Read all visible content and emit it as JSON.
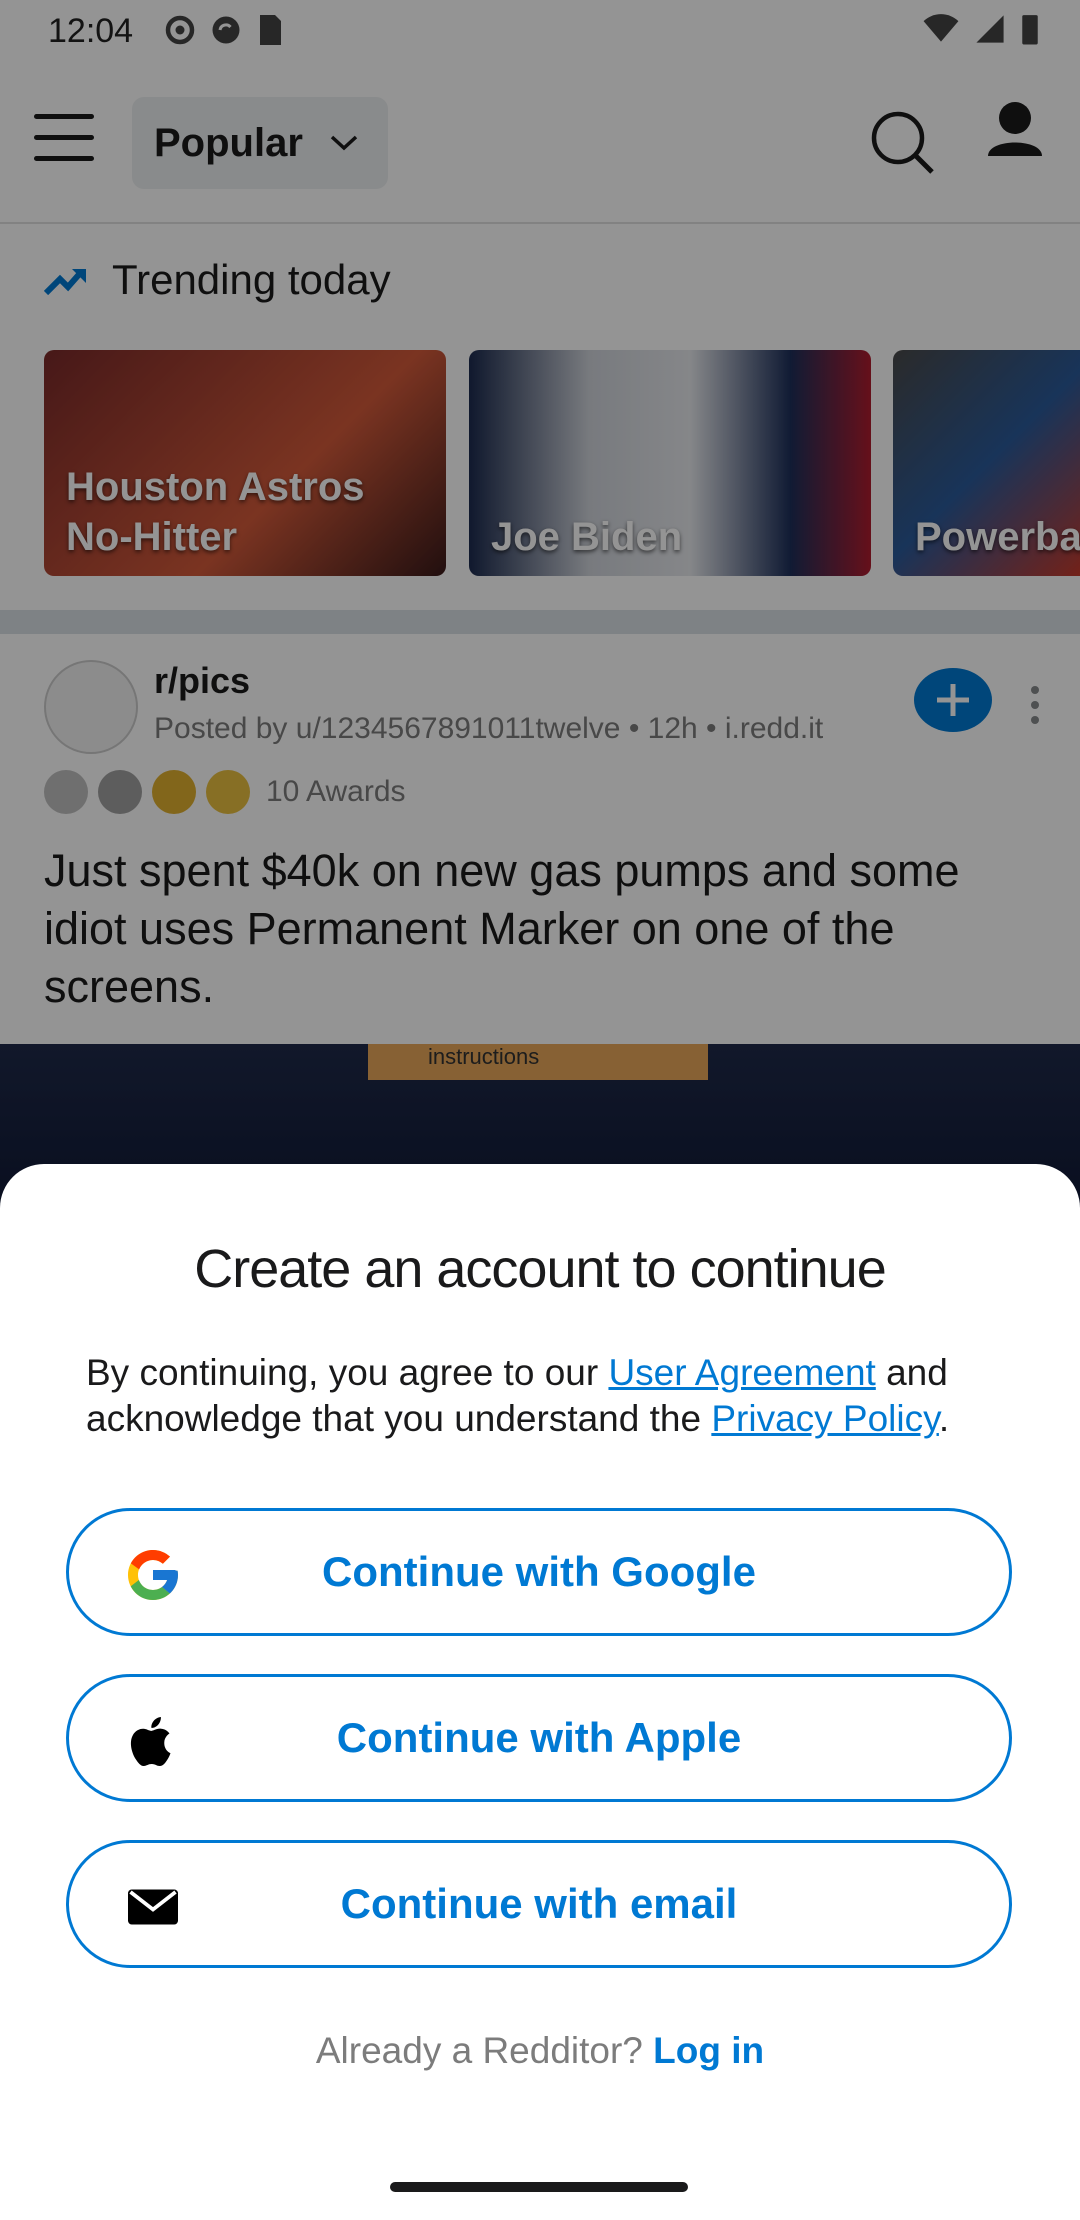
{
  "status": {
    "time": "12:04"
  },
  "header": {
    "feed_selector": "Popular"
  },
  "trending": {
    "heading": "Trending today",
    "cards": [
      {
        "label": "Houston Astros No-Hitter"
      },
      {
        "label": "Joe Biden"
      },
      {
        "label": "Powerba"
      }
    ]
  },
  "post": {
    "subreddit": "r/pics",
    "meta": "Posted by u/1234567891011twelve • 12h • i.redd.it",
    "awards_count": "10 Awards",
    "title": "Just spent $40k on new gas pumps and some idiot uses Permanent Marker on one of the screens.",
    "image_text": "instructions"
  },
  "sheet": {
    "title": "Create an account to continue",
    "terms_prefix": "By continuing, you agree to our ",
    "user_agreement": "User Agreement",
    "terms_middle": " and acknowledge that you understand the ",
    "privacy_policy": "Privacy Policy",
    "terms_suffix": ".",
    "buttons": [
      {
        "label": "Continue with Google",
        "icon": "google-icon"
      },
      {
        "label": "Continue with Apple",
        "icon": "apple-icon"
      },
      {
        "label": "Continue with email",
        "icon": "mail-icon"
      }
    ],
    "login_prompt": "Already a Redditor?",
    "login_link": "Log in"
  },
  "colors": {
    "accent": "#0079d3",
    "dim": "rgba(0,0,0,0.42)"
  }
}
